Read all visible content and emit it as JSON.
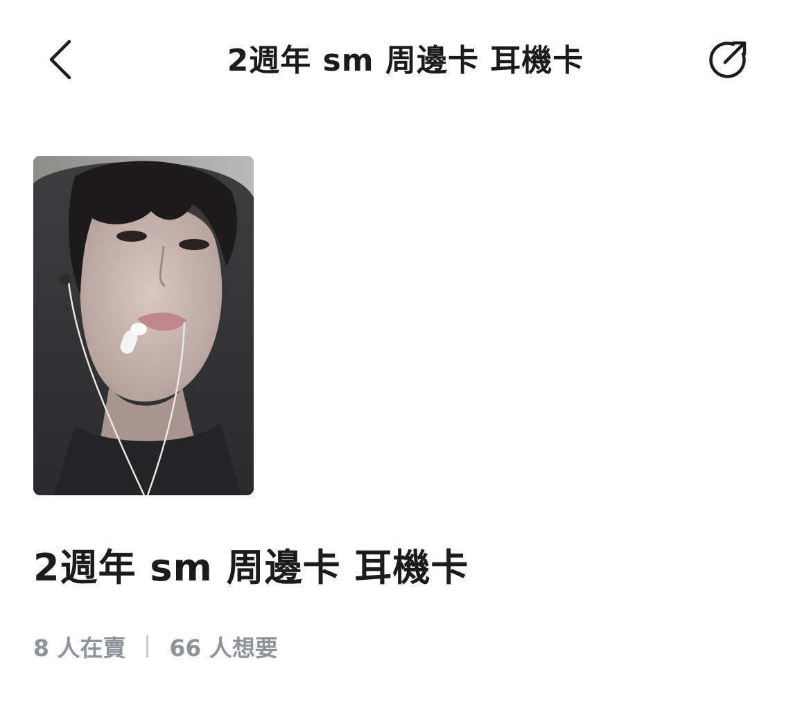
{
  "header": {
    "title": "2週年 sm 周邊卡 耳機卡",
    "back_icon": "chevron-left-icon",
    "share_icon": "share-external-icon"
  },
  "product": {
    "title": "2週年 sm 周邊卡 耳機卡",
    "sellers_text": "8 人在賣",
    "wanters_text": "66 人想要"
  },
  "colors": {
    "text_primary": "#1b1b1b",
    "text_secondary": "#8e9299",
    "separator": "#c9ccd1",
    "background": "#ffffff"
  }
}
